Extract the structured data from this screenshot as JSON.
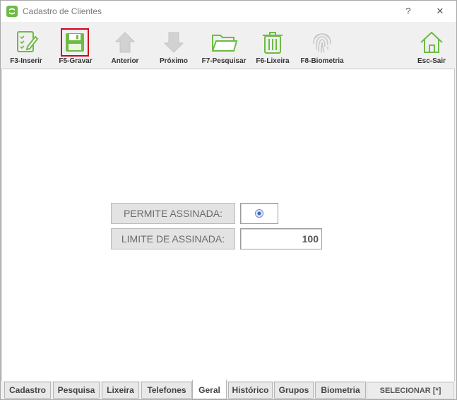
{
  "window": {
    "title": "Cadastro de Clientes",
    "help_label": "?",
    "close_label": "✕"
  },
  "toolbar": {
    "insert_label": "F3-Inserir",
    "save_label": "F5-Gravar",
    "previous_label": "Anterior",
    "next_label": "Próximo",
    "search_label": "F7-Pesquisar",
    "trash_label": "F6-Lixeira",
    "biometry_label": "F8-Biometria",
    "exit_label": "Esc-Sair"
  },
  "form": {
    "permit_signature_label": "PERMITE ASSINADA:",
    "signature_limit_label": "LIMITE DE ASSINADA:",
    "signature_limit_value": "100"
  },
  "tabs": [
    "Cadastro",
    "Pesquisa",
    "Lixeira",
    "Telefones",
    "Geral",
    "Histórico",
    "Grupos",
    "Biometria"
  ],
  "active_tab": "Geral",
  "select_button_label": "SELECIONAR [*]",
  "colors": {
    "accent_green": "#6dbb45",
    "disabled_gray": "#c8c8c8",
    "highlight_red": "#d0021b"
  }
}
